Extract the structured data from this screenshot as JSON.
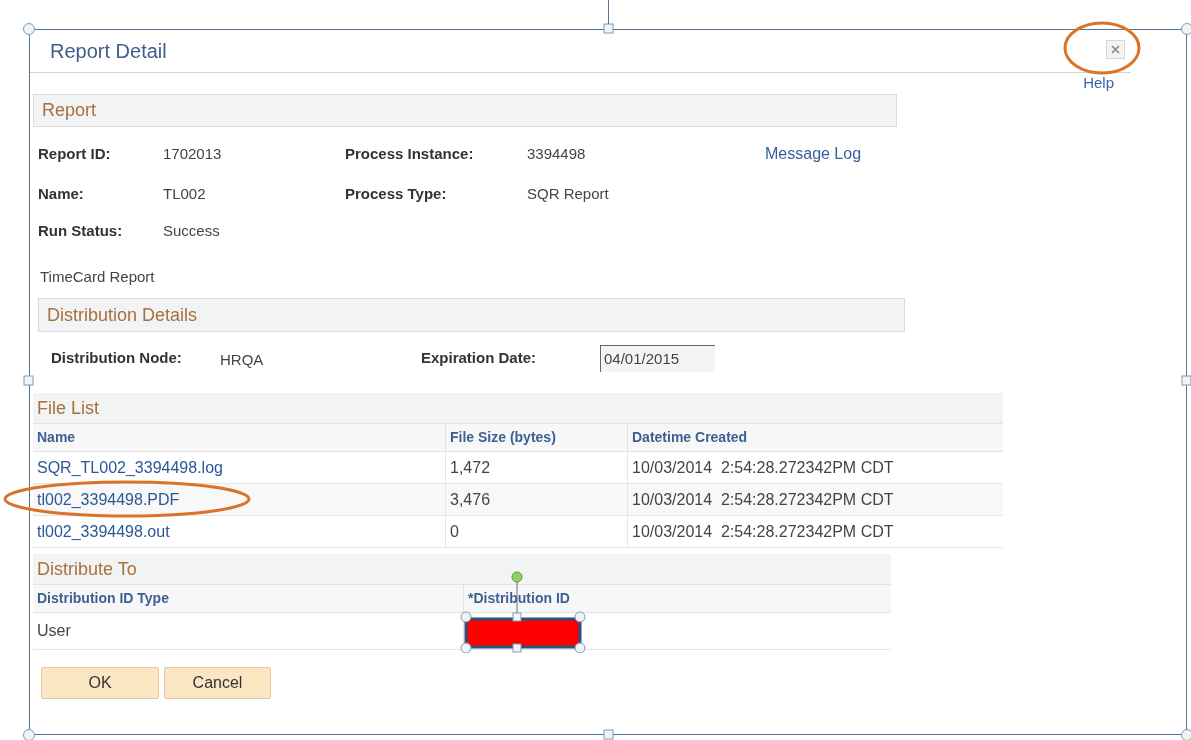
{
  "dialog": {
    "title": "Report Detail",
    "help": "Help",
    "report": {
      "heading": "Report",
      "fields": [
        {
          "label": "Report ID:",
          "value": "1702013"
        },
        {
          "label": "Process Instance:",
          "value": "3394498"
        },
        {
          "label": "Name:",
          "value": "TL002"
        },
        {
          "label": "Process Type:",
          "value": "SQR Report"
        },
        {
          "label": "Run Status:",
          "value": "Success"
        }
      ],
      "link": "Message Log",
      "description": "TimeCard Report"
    },
    "distribution_details": {
      "heading": "Distribution Details",
      "node_label": "Distribution Node:",
      "node_value": "HRQA",
      "expiration_label": "Expiration Date:",
      "expiration_value": "04/01/2015"
    },
    "file_list": {
      "heading": "File List",
      "columns": [
        "Name",
        "File Size (bytes)",
        "Datetime Created"
      ],
      "rows": [
        {
          "name": "SQR_TL002_3394498.log",
          "size": "1,472",
          "created": "10/03/2014  2:54:28.272342PM CDT"
        },
        {
          "name": "tl002_3394498.PDF",
          "size": "3,476",
          "created": "10/03/2014  2:54:28.272342PM CDT"
        },
        {
          "name": "tl002_3394498.out",
          "size": "0",
          "created": "10/03/2014  2:54:28.272342PM CDT"
        }
      ]
    },
    "distribute_to": {
      "heading": "Distribute To",
      "columns": [
        "Distribution ID Type",
        "*Distribution ID"
      ],
      "rows": [
        {
          "type": "User"
        }
      ]
    },
    "buttons": [
      "OK",
      "Cancel"
    ]
  }
}
